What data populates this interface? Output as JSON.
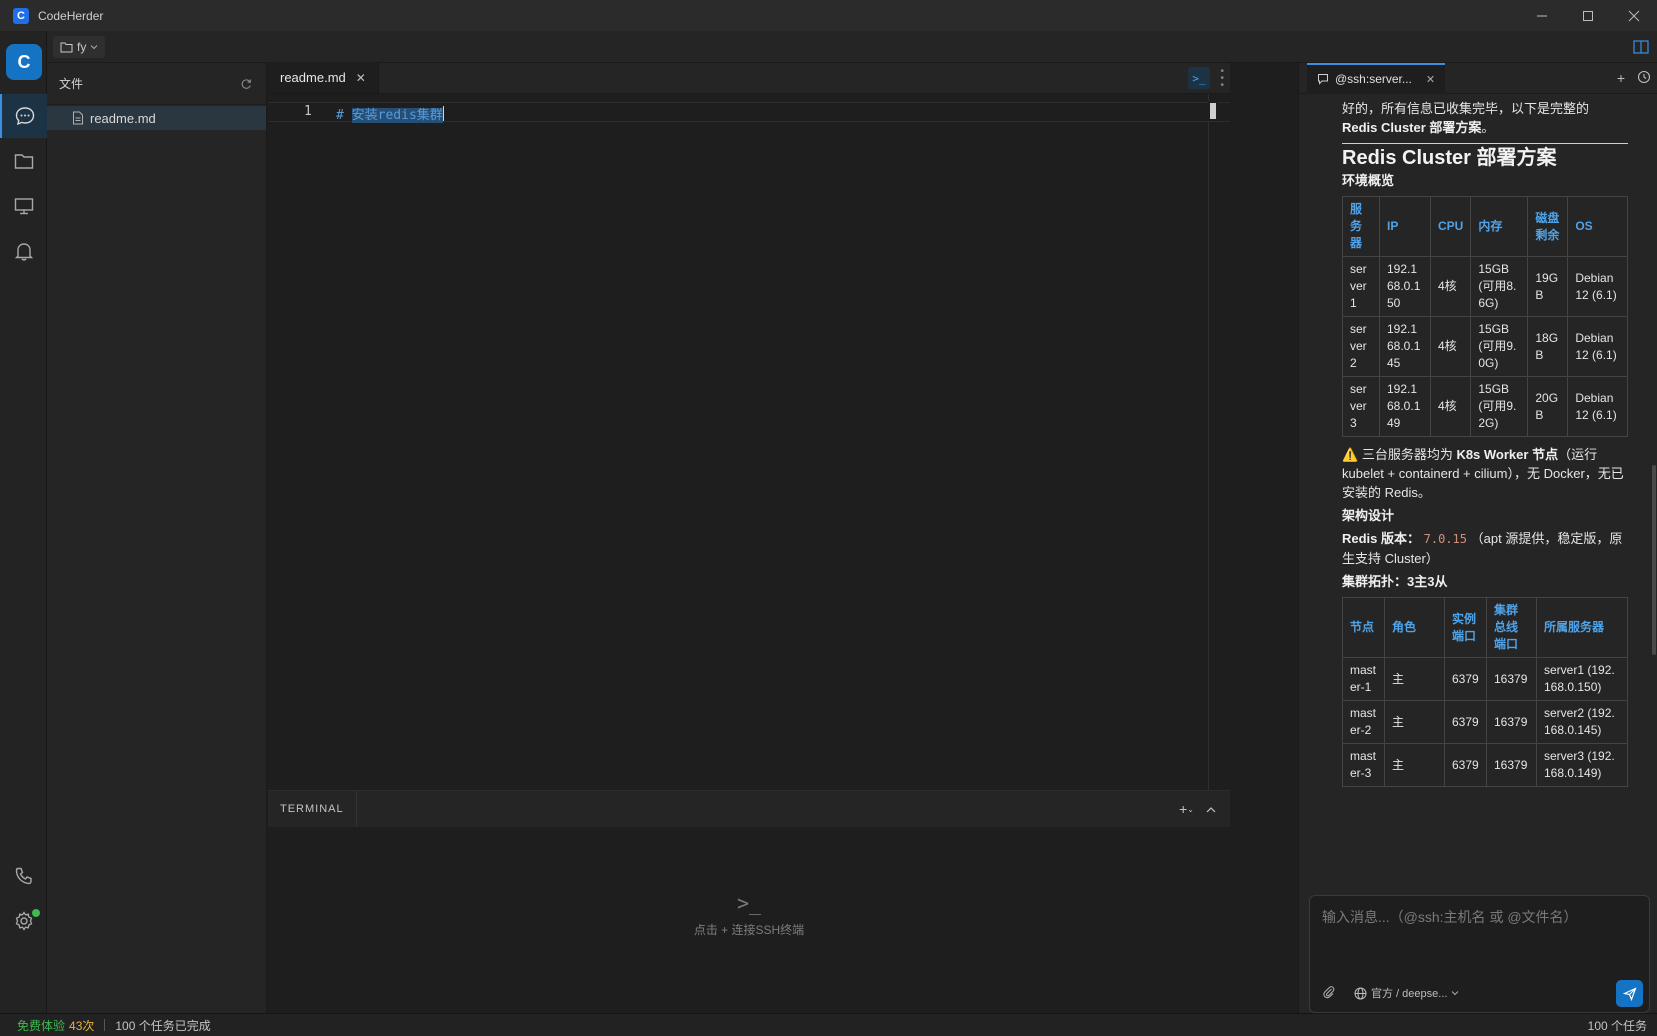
{
  "app": {
    "title": "CodeHerder",
    "logo_letter": "C"
  },
  "toolbar": {
    "folder": "fy"
  },
  "explorer": {
    "title": "文件",
    "files": [
      {
        "name": "readme.md"
      }
    ]
  },
  "editor": {
    "tab": "readme.md",
    "lines": [
      {
        "num": "1",
        "prefix": "# ",
        "text": "安装redis集群"
      }
    ]
  },
  "terminal": {
    "title": "TERMINAL",
    "empty_icon": ">_",
    "empty_hint": "点击 + 连接SSH终端"
  },
  "chat": {
    "tab": "@ssh:server...",
    "intro_text": "好的，所有信息已收集完毕，以下是完整的 ",
    "intro_bold": "Redis Cluster 部署方案",
    "intro_end": "。",
    "heading": "Redis Cluster 部署方案",
    "env_title": "环境概览",
    "env_headers": [
      "服务器",
      "IP",
      "CPU",
      "内存",
      "磁盘剩余",
      "OS"
    ],
    "env_rows": [
      [
        "server1",
        "192.168.0.150",
        "4核",
        "15GB (可用8.6G)",
        "19GB",
        "Debian 12 (6.1)"
      ],
      [
        "server2",
        "192.168.0.145",
        "4核",
        "15GB (可用9.0G)",
        "18GB",
        "Debian 12 (6.1)"
      ],
      [
        "server3",
        "192.168.0.149",
        "4核",
        "15GB (可用9.2G)",
        "20GB",
        "Debian 12 (6.1)"
      ]
    ],
    "warning_icon": "⚠️",
    "warning_pre": "三台服务器均为 ",
    "warning_bold": "K8s Worker 节点",
    "warning_post": "（运行 kubelet + containerd + cilium），无 Docker，无已安装的 Redis。",
    "arch_title": "架构设计",
    "version_label": "Redis 版本",
    "version_value": "7.0.15",
    "version_note": "（apt 源提供，稳定版，原生支持 Cluster）",
    "topology": "集群拓扑：3主3从",
    "topo_headers": [
      "节点",
      "角色",
      "实例端口",
      "集群总线端口",
      "所属服务器"
    ],
    "topo_rows": [
      [
        "master-1",
        "主",
        "6379",
        "16379",
        "server1 (192.168.0.150)"
      ],
      [
        "master-2",
        "主",
        "6379",
        "16379",
        "server2 (192.168.0.145)"
      ],
      [
        "master-3",
        "主",
        "6379",
        "16379",
        "server3 (192.168.0.149)"
      ]
    ],
    "input_placeholder": "输入消息...（@ssh:主机名 或 @文件名）",
    "model": "官方 / deepse..."
  },
  "statusbar": {
    "trial_label": "免费体验",
    "trial_count": "43次",
    "tasks_done": "100 个任务已完成",
    "tasks_total": "100 个任务"
  },
  "colors": {
    "accent": "#1473c3",
    "online": "#3fb950",
    "link": "#4fa3e8"
  }
}
